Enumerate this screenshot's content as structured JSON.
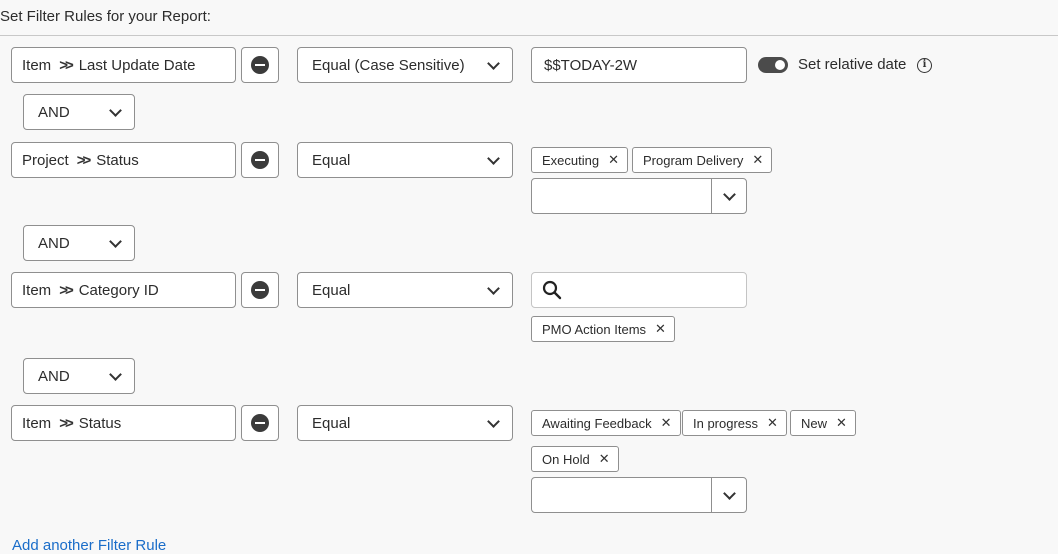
{
  "header": {
    "title": "Set Filter Rules for your Report:"
  },
  "rules": [
    {
      "field_object": "Item",
      "field_name": "Last Update Date",
      "operator": "Equal (Case Sensitive)",
      "value": "$$TODAY-2W",
      "relative_date_label": "Set relative date",
      "relative_date_on": true
    },
    {
      "field_object": "Project",
      "field_name": "Status",
      "operator": "Equal",
      "tags": [
        "Executing",
        "Program Delivery"
      ]
    },
    {
      "field_object": "Item",
      "field_name": "Category ID",
      "operator": "Equal",
      "tags": [
        "PMO Action Items"
      ]
    },
    {
      "field_object": "Item",
      "field_name": "Status",
      "operator": "Equal",
      "tags": [
        "Awaiting Feedback",
        "In progress",
        "New",
        "On Hold"
      ]
    }
  ],
  "connectors": [
    "AND",
    "AND",
    "AND"
  ],
  "add_rule_link": "Add another Filter Rule",
  "icons": {
    "remove": "minus-circle-icon",
    "chevron": "double-chevron-right-icon",
    "dropdown": "chevron-down-icon",
    "tag_remove": "close-icon",
    "search": "search-icon",
    "info": "info-icon"
  }
}
